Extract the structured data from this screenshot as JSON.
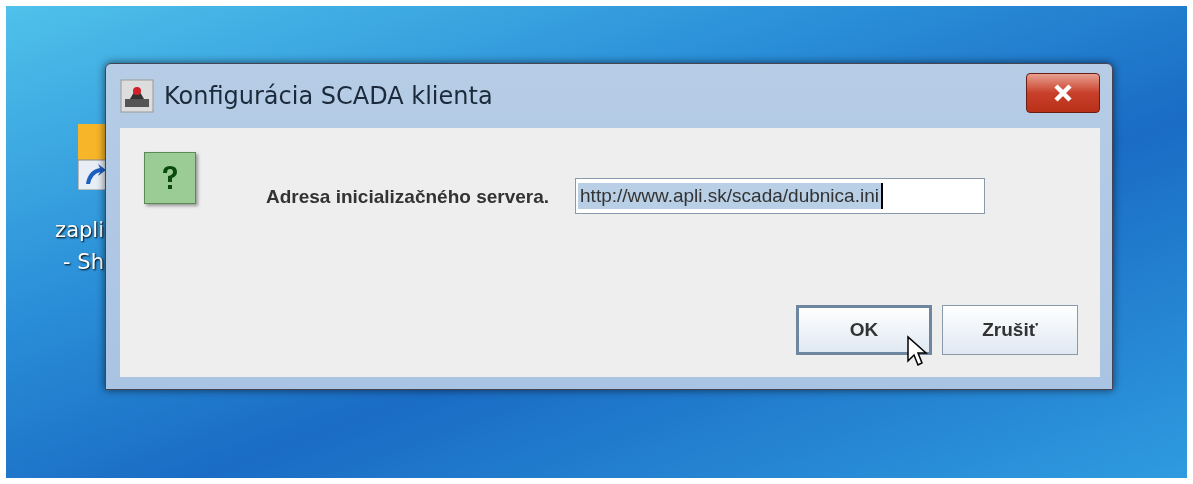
{
  "desktop": {
    "icon_label": [
      "zapli",
      "- Sh"
    ]
  },
  "window": {
    "title": "Konfigurácia SCADA klienta"
  },
  "prompt": {
    "label": "Adresa inicializačného servera.",
    "value": "http://www.apli.sk/scada/dubnica.ini"
  },
  "buttons": [
    {
      "label": "OK",
      "default": true
    },
    {
      "label": "Zrušiť",
      "default": false
    }
  ]
}
